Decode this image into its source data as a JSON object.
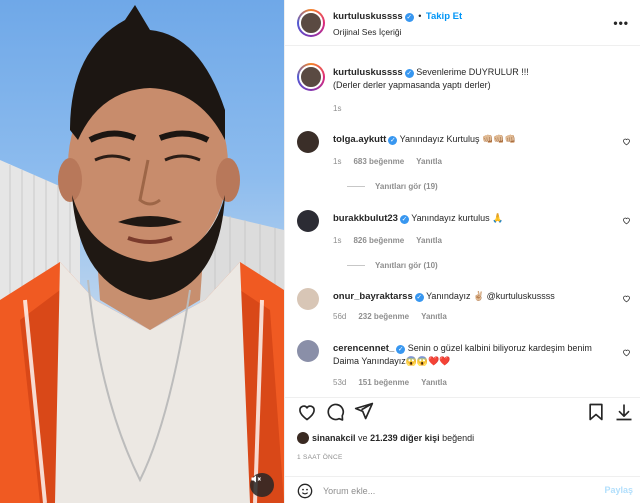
{
  "header": {
    "username": "kurtuluskussss",
    "follow_label": "Takip Et",
    "separator": "•",
    "subtitle": "Orijinal Ses İçeriği",
    "more_label": "•••"
  },
  "caption": {
    "username": "kurtuluskussss",
    "line1": "Sevenlerime DUYRULUR !!!",
    "line2": "(Derler derler yapmasanda yaptı derler)",
    "time": "1s"
  },
  "comments": [
    {
      "username": "tolga.aykutt",
      "text": "Yanındayız Kurtuluş 👊🏼👊🏼👊🏼",
      "time": "1s",
      "likes": "683 beğenme",
      "reply": "Yanıtla",
      "view_replies": "Yanıtları gör (19)"
    },
    {
      "username": "burakkbulut23",
      "text": "Yanındayız kurtulus 🙏",
      "time": "1s",
      "likes": "826 beğenme",
      "reply": "Yanıtla",
      "view_replies": "Yanıtları gör (10)"
    },
    {
      "username": "onur_bayraktarss",
      "text": "Yanındayız ✌🏼 @kurtuluskussss",
      "time": "56d",
      "likes": "232 beğenme",
      "reply": "Yanıtla"
    },
    {
      "username": "cerencennet_",
      "text": "Senin o güzel kalbini biliyoruz kardeşim benim",
      "text2": "Daima Yanındayız😱😱❤️❤️",
      "time": "53d",
      "likes": "151 beğenme",
      "reply": "Yanıtla"
    }
  ],
  "likes_line": {
    "user": "sinanakcil",
    "connector": "ve",
    "others": "21.239 diğer kişi",
    "suffix": "beğendi"
  },
  "timestamp": "1 SAAT ÖNCE",
  "composer": {
    "placeholder": "Yorum ekle...",
    "share_label": "Paylaş"
  },
  "icons": [
    "heart-icon",
    "comment-icon",
    "share-icon",
    "save-icon",
    "download-icon",
    "emoji-icon",
    "mute-icon"
  ],
  "colors": {
    "follow": "#0095f6",
    "verified": "#3897f0",
    "jacket": "#f05a22"
  }
}
